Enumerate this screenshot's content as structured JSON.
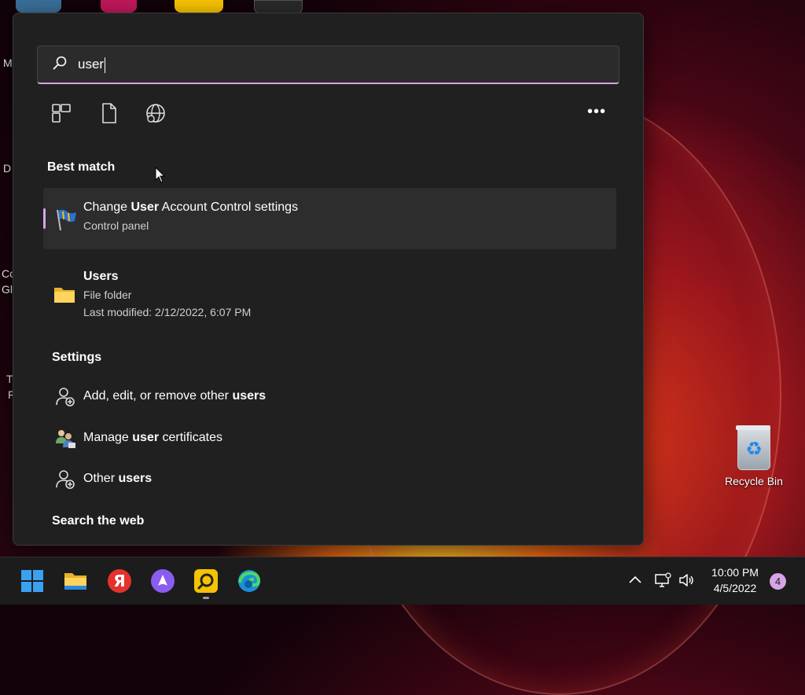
{
  "desktop": {
    "edge_labels": [
      "M",
      "D",
      "Co",
      "Gl",
      "T",
      "F"
    ],
    "recycle_bin_label": "Recycle Bin"
  },
  "search": {
    "query": "user",
    "filters": [
      "apps-filter-icon",
      "documents-filter-icon",
      "web-filter-icon"
    ],
    "more_label": "•••"
  },
  "best_match": {
    "heading": "Best match",
    "title_before": "Change ",
    "title_bold": "User",
    "title_after": " Account Control settings",
    "subtitle": "Control panel",
    "icon": "uac-flag-icon"
  },
  "users_folder": {
    "title": "Users",
    "type": "File folder",
    "modified": "Last modified: 2/12/2022, 6:07 PM",
    "icon": "folder-icon"
  },
  "settings": {
    "heading": "Settings",
    "items": [
      {
        "before": "Add, edit, or remove other ",
        "bold": "users",
        "after": "",
        "icon": "user-add-icon"
      },
      {
        "before": "Manage ",
        "bold": "user",
        "after": " certificates",
        "icon": "user-certificates-icon"
      },
      {
        "before": "Other ",
        "bold": "users",
        "after": "",
        "icon": "user-add-icon"
      }
    ]
  },
  "web": {
    "heading": "Search the web"
  },
  "taskbar": {
    "apps": [
      "start-icon",
      "file-explorer-icon",
      "yandex-browser-icon",
      "alice-icon",
      "lightshot-icon",
      "edge-icon"
    ],
    "time": "10:00 PM",
    "date": "4/5/2022",
    "notifications": "4"
  }
}
